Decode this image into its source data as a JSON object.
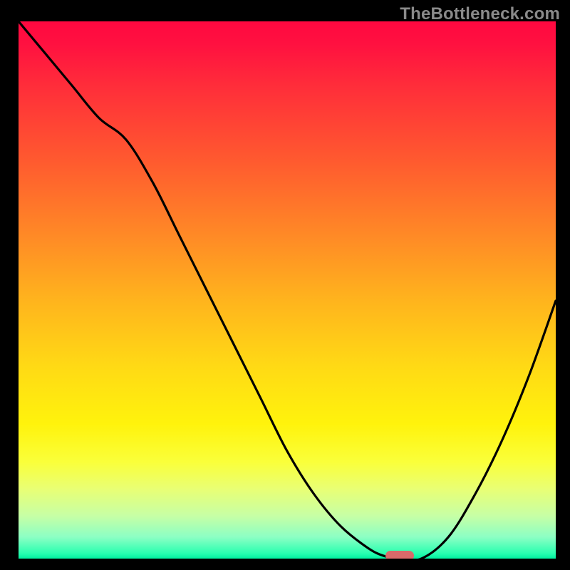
{
  "watermark": "TheBottleneck.com",
  "colors": {
    "background": "#000000",
    "gradient_top": "#ff0840",
    "gradient_bottom": "#00f0a0",
    "curve": "#000000",
    "marker": "#d96a6a"
  },
  "chart_data": {
    "type": "line",
    "title": "",
    "xlabel": "",
    "ylabel": "",
    "xlim": [
      0,
      100
    ],
    "ylim": [
      0,
      100
    ],
    "series": [
      {
        "name": "bottleneck-curve",
        "x": [
          0,
          5,
          10,
          15,
          20,
          25,
          30,
          35,
          40,
          45,
          50,
          55,
          60,
          65,
          68,
          71,
          75,
          80,
          85,
          90,
          95,
          100
        ],
        "values": [
          100,
          94,
          88,
          82,
          78,
          70,
          60,
          50,
          40,
          30,
          20,
          12,
          6,
          2,
          0.5,
          0,
          0,
          4,
          12,
          22,
          34,
          48
        ]
      }
    ],
    "annotations": [
      {
        "name": "optimal-marker",
        "x": 71,
        "y": 0.5
      }
    ]
  }
}
